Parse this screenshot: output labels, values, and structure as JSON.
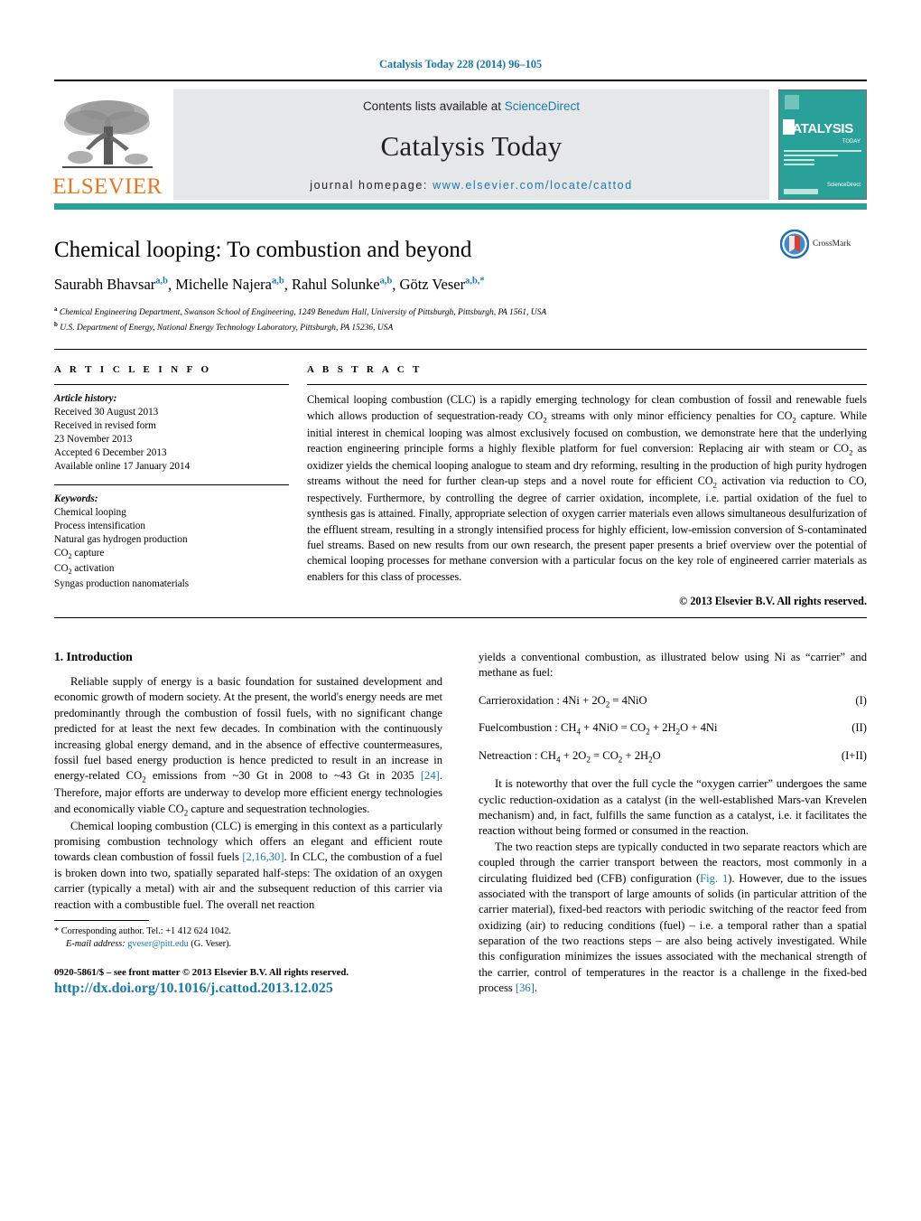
{
  "running_head": "Catalysis Today 228 (2014) 96–105",
  "masthead": {
    "publisher_wordmark": "ELSEVIER",
    "contents_prefix": "Contents lists available at ",
    "contents_link": "ScienceDirect",
    "journal_name": "Catalysis Today",
    "homepage_prefix": "journal homepage: ",
    "homepage_url": "www.elsevier.com/locate/cattod",
    "cover_title": "CATALYSIS",
    "cover_subtitle": "TODAY",
    "cover_sciencedirect": "ScienceDirect",
    "brand_teal": "#2aa198",
    "brand_orange": "#E87722",
    "link_blue": "#1a7aa8"
  },
  "article": {
    "title": "Chemical looping: To combustion and beyond",
    "authors": [
      {
        "name": "Saurabh Bhavsar",
        "sup": "a,b"
      },
      {
        "name": "Michelle Najera",
        "sup": "a,b"
      },
      {
        "name": "Rahul Solunke",
        "sup": "a,b"
      },
      {
        "name": "Götz Veser",
        "sup": "a,b,*"
      }
    ],
    "affiliations": [
      {
        "marker": "a",
        "text": "Chemical Engineering Department, Swanson School of Engineering, 1249 Benedum Hall, University of Pittsburgh, Pittsburgh, PA 1561, USA"
      },
      {
        "marker": "b",
        "text": "U.S. Department of Energy, National Energy Technology Laboratory, Pittsburgh, PA 15236, USA"
      }
    ],
    "crossmark_label": "CrossMark"
  },
  "article_info": {
    "heading": "A R T I C L E   I N F O",
    "history_label": "Article history:",
    "history": [
      "Received 30 August 2013",
      "Received in revised form",
      "23 November 2013",
      "Accepted 6 December 2013",
      "Available online 17 January 2014"
    ],
    "keywords_label": "Keywords:",
    "keywords": [
      "Chemical looping",
      "Process intensification",
      "Natural gas hydrogen production",
      "CO2 capture",
      "CO2 activation",
      "Syngas production nanomaterials"
    ]
  },
  "abstract": {
    "heading": "A B S T R A C T",
    "text": "Chemical looping combustion (CLC) is a rapidly emerging technology for clean combustion of fossil and renewable fuels which allows production of sequestration-ready CO2 streams with only minor efficiency penalties for CO2 capture. While initial interest in chemical looping was almost exclusively focused on combustion, we demonstrate here that the underlying reaction engineering principle forms a highly flexible platform for fuel conversion: Replacing air with steam or CO2 as oxidizer yields the chemical looping analogue to steam and dry reforming, resulting in the production of high purity hydrogen streams without the need for further clean-up steps and a novel route for efficient CO2 activation via reduction to CO, respectively. Furthermore, by controlling the degree of carrier oxidation, incomplete, i.e. partial oxidation of the fuel to synthesis gas is attained. Finally, appropriate selection of oxygen carrier materials even allows simultaneous desulfurization of the effluent stream, resulting in a strongly intensified process for highly efficient, low-emission conversion of S-contaminated fuel streams. Based on new results from our own research, the present paper presents a brief overview over the potential of chemical looping processes for methane conversion with a particular focus on the key role of engineered carrier materials as enablers for this class of processes.",
    "copyright": "© 2013 Elsevier B.V. All rights reserved."
  },
  "body": {
    "section_1_title": "1.  Introduction",
    "left_paragraphs": [
      "Reliable supply of energy is a basic foundation for sustained development and economic growth of modern society. At the present, the world's energy needs are met predominantly through the combustion of fossil fuels, with no significant change predicted for at least the next few decades. In combination with the continuously increasing global energy demand, and in the absence of effective countermeasures, fossil fuel based energy production is hence predicted to result in an increase in energy-related CO2 emissions from ~30 Gt in 2008 to ~43 Gt in 2035 [24]. Therefore, major efforts are underway to develop more efficient energy technologies and economically viable CO2 capture and sequestration technologies.",
      "Chemical looping combustion (CLC) is emerging in this context as a particularly promising combustion technology which offers an elegant and efficient route towards clean combustion of fossil fuels [2,16,30]. In CLC, the combustion of a fuel is broken down into two, spatially separated half-steps: The oxidation of an oxygen carrier (typically a metal) with air and the subsequent reduction of this carrier via reaction with a combustible fuel. The overall net reaction"
    ],
    "right_lead": "yields a conventional combustion, as illustrated below using Ni as “carrier” and methane as fuel:",
    "equations": [
      {
        "label": "Carrieroxidation : 4Ni + 2O2 = 4NiO",
        "number": "(I)"
      },
      {
        "label": "Fuelcombustion : CH4 + 4NiO = CO2 + 2H2O + 4Ni",
        "number": "(II)"
      },
      {
        "label": "Netreaction : CH4 + 2O2 = CO2 + 2H2O",
        "number": "(I+II)"
      }
    ],
    "right_paragraphs": [
      "It is noteworthy that over the full cycle the “oxygen carrier” undergoes the same cyclic reduction-oxidation as a catalyst (in the well-established Mars-van Krevelen mechanism) and, in fact, fulfills the same function as a catalyst, i.e. it facilitates the reaction without being formed or consumed in the reaction.",
      "The two reaction steps are typically conducted in two separate reactors which are coupled through the carrier transport between the reactors, most commonly in a circulating fluidized bed (CFB) configuration (Fig. 1). However, due to the issues associated with the transport of large amounts of solids (in particular attrition of the carrier material), fixed-bed reactors with periodic switching of the reactor feed from oxidizing (air) to reducing conditions (fuel) – i.e. a temporal rather than a spatial separation of the two reactions steps – are also being actively investigated. While this configuration minimizes the issues associated with the mechanical strength of the carrier, control of temperatures in the reactor is a challenge in the fixed-bed process [36]."
    ]
  },
  "footer": {
    "corresponding_marker": "*",
    "corresponding_text": "Corresponding author. Tel.: +1 412 624 1042.",
    "email_label": "E-mail address:",
    "email": "gveser@pitt.edu",
    "email_suffix": "(G. Veser).",
    "front_matter": "0920-5861/$ – see front matter © 2013 Elsevier B.V. All rights reserved.",
    "doi": "http://dx.doi.org/10.1016/j.cattod.2013.12.025"
  }
}
